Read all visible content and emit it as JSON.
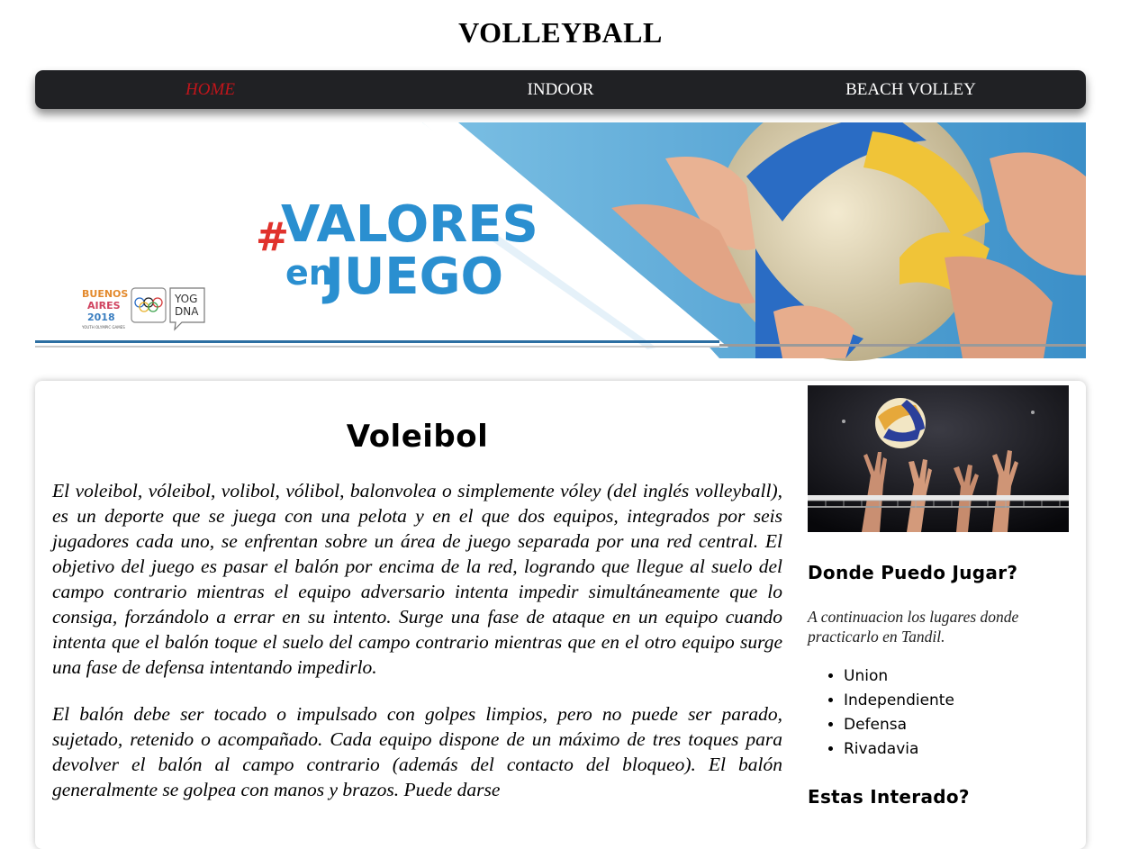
{
  "site": {
    "title": "VOLLEYBALL"
  },
  "nav": {
    "items": [
      {
        "label": "HOME"
      },
      {
        "label": "INDOOR"
      },
      {
        "label": "BEACH VOLLEY"
      }
    ]
  },
  "banner": {
    "hashtag": "#",
    "word1": "VALORES",
    "word2": "en",
    "word3": "JUEGO",
    "logo_city_lines": [
      "BUENOS",
      "AIRES",
      "2018"
    ],
    "logo_small": "YOUTH OLYMPIC GAMES",
    "badge_lines": [
      "YOG",
      "DNA"
    ]
  },
  "main": {
    "title": "Voleibol",
    "paragraphs": [
      "El voleibol, vóleibol, volibol, vólibol, balonvolea o simplemente vóley (del inglés volleyball), es un deporte que se juega con una pelota y en el que dos equipos, integrados por seis jugadores cada uno, se enfrentan sobre un área de juego separada por una red central. El objetivo del juego es pasar el balón por encima de la red, logrando que llegue al suelo del campo contrario mientras el equipo adversario intenta impedir simultáneamente que lo consiga, forzándolo a errar en su intento. Surge una fase de ataque en un equipo cuando intenta que el balón toque el suelo del campo contrario mientras que en el otro equipo surge una fase de defensa intentando impedirlo.",
      "El balón debe ser tocado o impulsado con golpes limpios, pero no puede ser parado, sujetado, retenido o acompañado. Cada equipo dispone de un máximo de tres toques para devolver el balón al campo contrario (además del contacto del bloqueo). El balón generalmente se golpea con manos y brazos. Puede darse"
    ]
  },
  "aside": {
    "heading": "Donde Puedo Jugar?",
    "intro": "A continuacion los lugares donde practicarlo en Tandil.",
    "places": [
      "Union",
      "Independiente",
      "Defensa",
      "Rivadavia"
    ],
    "heading2": "Estas Interado?"
  },
  "colors": {
    "navbar_bg": "#202124",
    "nav_active": "#c0151b",
    "banner_blue": "#2a8fd0",
    "banner_red": "#e0322c"
  }
}
